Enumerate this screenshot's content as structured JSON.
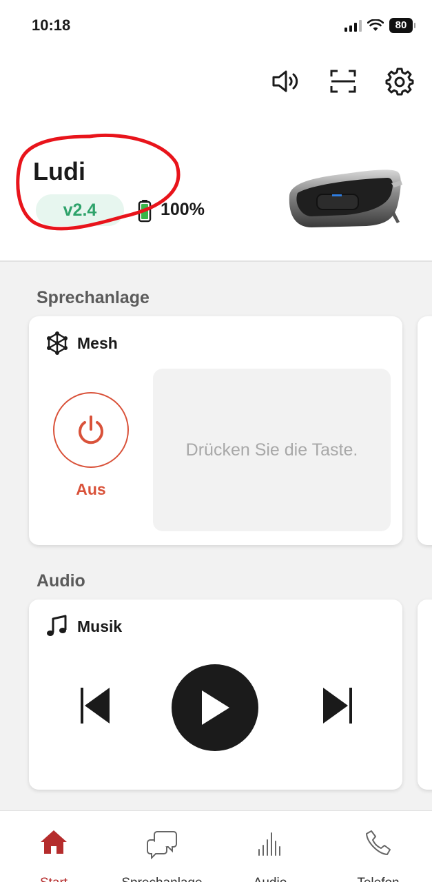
{
  "status_bar": {
    "time": "10:18",
    "battery": "80",
    "icons": [
      "cellular-signal-icon",
      "wifi-icon",
      "battery-icon"
    ]
  },
  "toolbar": {
    "icons": [
      "speaker-volume-icon",
      "scan-icon",
      "settings-gear-icon"
    ]
  },
  "device": {
    "name": "Ludi",
    "version": "v2.4",
    "battery_percent": "100%",
    "battery_level": 1.0
  },
  "sections": {
    "intercom": {
      "title": "Sprechanlage",
      "card_title": "Mesh",
      "power_state": "Aus",
      "hint": "Drücken Sie die Taste."
    },
    "audio": {
      "title": "Audio",
      "card_title": "Musik",
      "controls": [
        "previous-track",
        "play",
        "next-track"
      ]
    }
  },
  "tabbar": {
    "tabs": [
      {
        "label": "Start",
        "icon": "home-icon",
        "active": true
      },
      {
        "label": "Sprechanlage",
        "icon": "chat-bubbles-icon",
        "active": false
      },
      {
        "label": "Audio",
        "icon": "audio-bars-icon",
        "active": false
      },
      {
        "label": "Telefon",
        "icon": "phone-icon",
        "active": false
      }
    ]
  },
  "colors": {
    "accent_red": "#d9523a",
    "tab_active": "#b52c2c",
    "version_green": "#2fa36b",
    "annotation_red": "#e8141b"
  }
}
